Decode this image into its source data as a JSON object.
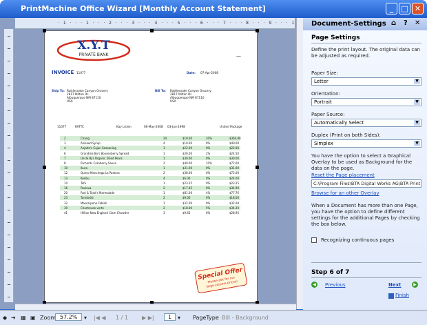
{
  "window": {
    "title": "PrintMachine Office Wizard [Monthly Account Statement]"
  },
  "ruler": {
    "marks": "· 1 · · · 1 · · · 2 · · · 3 · · · 4 · · · 5 · · · 6 · · · 7 · · · 8 · · · 9 · · · 10 · · · 11 · · · 12 · · · 13"
  },
  "doc": {
    "logo": "X.Y.T",
    "logo_sub": "PRIVATE BANK",
    "invoice_label": "INVOICE",
    "invoice_no": "11077",
    "date_label": "Date:",
    "date": "07-Apr-2008",
    "ship_label": "Ship To:",
    "ship_lines": [
      "Rattlesnake Canyon Grocery",
      "2817 Milton Dr.",
      "Albuquerque NM 87110",
      "USA"
    ],
    "bill_label": "Bill To:",
    "bill_lines": [
      "Rattlesnake Canyon Grocery",
      "2817 Milton Dr.",
      "Albuquerque NM 87110",
      "USA"
    ],
    "info": [
      "11077",
      "RATTC",
      "Kay Listen",
      "06-May-2008",
      "03-Jun-1998",
      "United Package"
    ],
    "rows": [
      [
        "2",
        "Chang",
        "24",
        "$19.00",
        "20%",
        "$364.80"
      ],
      [
        "3",
        "Aniseed Syrup",
        "4",
        "$10.00",
        "0%",
        "$40.00"
      ],
      [
        "4",
        "Anjatlo's Cajun Seasoning",
        "1",
        "$22.00",
        "0%",
        "$22.00"
      ],
      [
        "6",
        "Grandma Bo's Boysenberry Spread",
        "1",
        "$26.00",
        "2%",
        "$24.50"
      ],
      [
        "7",
        "Uncle Bj's Organic Dried Pears",
        "1",
        "$30.00",
        "0%",
        "$30.00"
      ],
      [
        "8",
        "Richards Cranberry Sauce",
        "2",
        "$40.00",
        "10%",
        "$72.00"
      ],
      [
        "10",
        "Ikura",
        "1",
        "$31.00",
        "0%",
        "$31.00"
      ],
      [
        "12",
        "Queso Manchego La Pastora",
        "2",
        "$38.00",
        "0%",
        "$72.00"
      ],
      [
        "13",
        "Konbu",
        "4",
        "$6.00",
        "0%",
        "$24.00"
      ],
      [
        "14",
        "Tofu",
        "1",
        "$23.25",
        "0%",
        "$23.25"
      ],
      [
        "16",
        "Pavlova",
        "2",
        "$17.45",
        "0%",
        "$34.90"
      ],
      [
        "20",
        "Rod & Todd's Marmalade",
        "1",
        "$81.00",
        "4%",
        "$77.76"
      ],
      [
        "23",
        "Tunnbröd",
        "2",
        "$9.00",
        "0%",
        "$18.00"
      ],
      [
        "32",
        "Mascarpone Fabioli",
        "1",
        "$32.00",
        "0%",
        "$32.00"
      ],
      [
        "39",
        "Chartreuse verte",
        "2",
        "$18.00",
        "5%",
        "$34.20"
      ],
      [
        "41",
        "Hillion New England Clam Chowder",
        "3",
        "$9.65",
        "0%",
        "$28.95"
      ]
    ],
    "offer_title": "Special Offer",
    "offer_lines": [
      "Please ask for our",
      "large volume prices!"
    ]
  },
  "status": {
    "zoom_label": "Zoom",
    "zoom": "57.2%",
    "page_count": "1 / 1",
    "page_num": "1",
    "page_type": "PageType",
    "page_type_value": "Bill - Background"
  },
  "panel": {
    "title": "Document-Settings",
    "section": "Page Settings",
    "intro": "Define the print layout. The original data can be adjusted as required.",
    "paper_size_label": "Paper Size:",
    "paper_size": "Letter",
    "orientation_label": "Orientation:",
    "orientation": "Portrait",
    "source_label": "Paper Source:",
    "source": "Automatically Select",
    "duplex_label": "Duplex (Print on both Sides):",
    "duplex": "Simplex",
    "overlay_text": "You have the option to select a Graphical Overlay to be used as Background for the data on the page.",
    "reset_link": "Reset the Page placement",
    "overlay_path": "C:\\Program Files\\BTA Digital Works AG\\BTA Print",
    "browse_link": "Browse for an other Overlay",
    "multi_text": "When a Document has more than one Page, you have the option to define different settings for the additional Pages by checking the box below.",
    "checkbox_label": "Recognizing continuous pages",
    "step": "Step 6 of 7",
    "previous": "Previous",
    "next": "Next",
    "finish": "Finish"
  },
  "colors": {
    "title_bar": "#1f5ccc",
    "panel_header": "#a8c0ea",
    "link": "#1c4fbf",
    "row_alt": "#d5ecd5",
    "offer": "#d42a1a"
  }
}
